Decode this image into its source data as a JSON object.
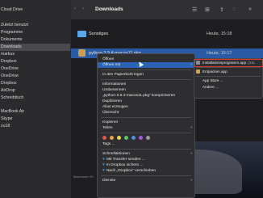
{
  "sidebar": {
    "items": [
      {
        "label": "Cloud Drive",
        "selected": false
      },
      {
        "label": "Zuletzt benutzt",
        "selected": false
      },
      {
        "label": "Programme",
        "selected": false
      },
      {
        "label": "Dokumente",
        "selected": false
      },
      {
        "label": "Downloads",
        "selected": true
      },
      {
        "label": "markus",
        "selected": false
      },
      {
        "label": "Dropbox",
        "selected": false
      },
      {
        "label": "OneDrive",
        "selected": false
      },
      {
        "label": "OneDrive",
        "selected": false
      },
      {
        "label": "Dropbox",
        "selected": false
      },
      {
        "label": "AirDrop",
        "selected": false
      },
      {
        "label": "Schreibtisch",
        "selected": false
      },
      {
        "label": "MacBook Air",
        "selected": false
      },
      {
        "label": "Skype",
        "selected": false
      },
      {
        "label": "zu18",
        "selected": false
      }
    ]
  },
  "toolbar": {
    "back": "‹",
    "forward": "›",
    "title": "Downloads",
    "list_icon": "☰",
    "grid_icon": "⊞",
    "share_icon": "⇪",
    "tag_icon": "◌",
    "more_icon": "»"
  },
  "files": [
    {
      "name": "Sonstiges",
      "date": "Heute, 15:18",
      "kind": "folder"
    },
    {
      "name": "python-3.9.4-macos11.pkg",
      "date": "Heute, 15:17",
      "kind": "package"
    }
  ],
  "pathbar": "Macintosh HD",
  "context_menu": {
    "items": [
      {
        "label": "Öffnen",
        "highlighted": false,
        "submenu": false
      },
      {
        "label": "Öffnen mit",
        "highlighted": true,
        "submenu": true
      },
      {
        "sep": true
      },
      {
        "label": "In den Papierkorb legen"
      },
      {
        "sep": true
      },
      {
        "label": "Informationen"
      },
      {
        "label": "Umbenennen"
      },
      {
        "label": "„python-3.9.4-macos11.pkg“ komprimieren"
      },
      {
        "label": "Duplizieren"
      },
      {
        "label": "Alias erzeugen"
      },
      {
        "label": "Übersicht"
      },
      {
        "sep": true
      },
      {
        "label": "Kopieren"
      },
      {
        "label": "Teilen",
        "submenu": true
      },
      {
        "sep": true
      },
      {
        "tags": true
      },
      {
        "label": "Tags ..."
      },
      {
        "sep": true
      },
      {
        "label": "Schnellaktionen",
        "submenu": true
      },
      {
        "label": "Mit Transfer senden ...",
        "cloud": true
      },
      {
        "label": "In Dropbox sichern ...",
        "cloud": true
      },
      {
        "label": "Nach „Dropbox“ verschieben",
        "cloud": true
      },
      {
        "sep": true
      },
      {
        "label": "Dienste",
        "submenu": true
      }
    ],
    "tag_colors": [
      "#e5534b",
      "#e8a33d",
      "#e6d34a",
      "#5cc46a",
      "#4b8de0",
      "#a35ad8",
      "#9a9aa0"
    ]
  },
  "open_with_submenu": {
    "items": [
      {
        "label": "Installationsprogramm.app",
        "suffix": "(Sta",
        "icon_color": "#8a8a90"
      },
      {
        "sep": true
      },
      {
        "label": "Entpacken.app",
        "icon_color": "#cfa64a"
      },
      {
        "sep": true
      },
      {
        "label": "App Store ..."
      },
      {
        "label": "Andere ..."
      }
    ]
  }
}
